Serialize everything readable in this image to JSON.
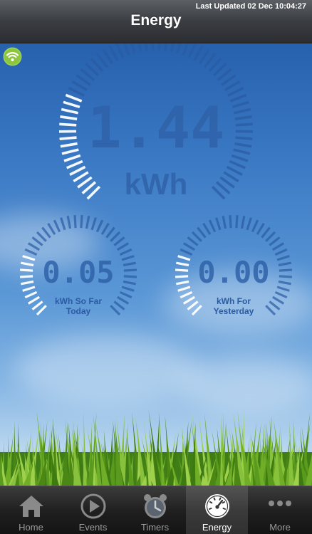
{
  "status": {
    "last_updated": "Last Updated 02 Dec 10:04:27"
  },
  "nav": {
    "title": "Energy"
  },
  "connection": {
    "icon": "wifi-icon",
    "color": "#8cc63f"
  },
  "gauges": {
    "main": {
      "value": "1.44",
      "unit": "kWh",
      "level": 0.25
    },
    "today": {
      "value": "0.05",
      "label_line1": "kWh So Far",
      "label_line2": "Today",
      "level": 0.25
    },
    "yesterday": {
      "value": "0.00",
      "label_line1": "kWh For",
      "label_line2": "Yesterday",
      "level": 0.25
    }
  },
  "tabs": [
    {
      "label": "Home",
      "icon": "home-icon",
      "active": false
    },
    {
      "label": "Events",
      "icon": "play-icon",
      "active": false
    },
    {
      "label": "Timers",
      "icon": "alarm-clock-icon",
      "active": false
    },
    {
      "label": "Energy",
      "icon": "speedometer-icon",
      "active": true
    },
    {
      "label": "More",
      "icon": "more-icon",
      "active": false
    }
  ],
  "colors": {
    "gauge_lit": "#ffffff",
    "gauge_dim": "#2a5ba3",
    "digits": "#2f62a8",
    "navbar": "#3a3d42",
    "tabbar": "#1a1a1a"
  }
}
